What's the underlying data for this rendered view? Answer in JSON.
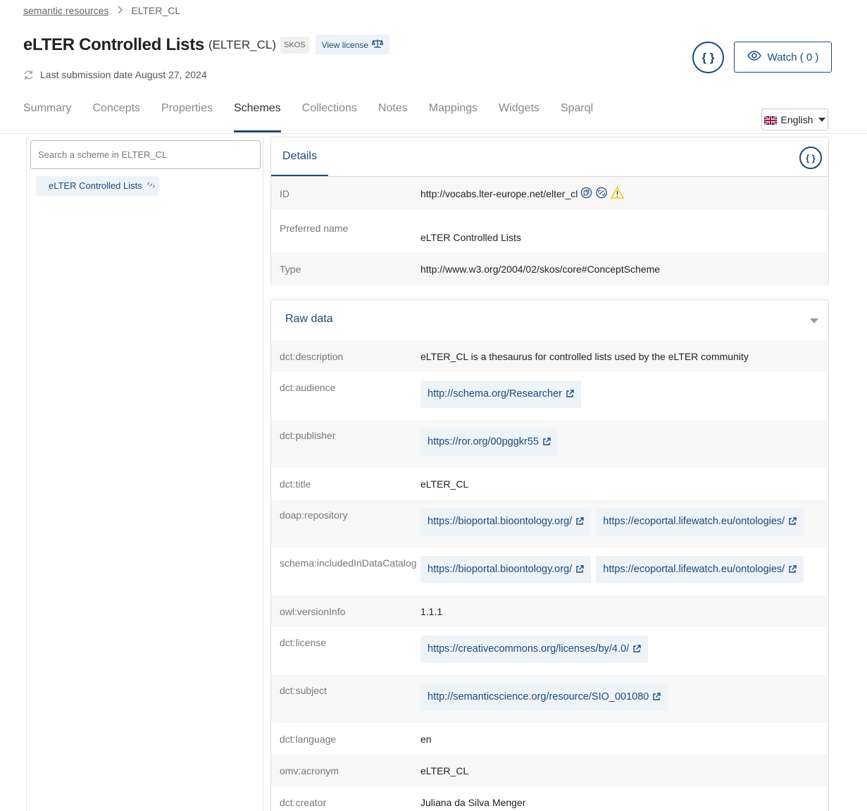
{
  "breadcrumb": {
    "root": "semantic resources",
    "current": "ELTER_CL"
  },
  "header": {
    "title": "eLTER Controlled Lists",
    "acronym": "(ELTER_CL)",
    "format": "SKOS",
    "license_label": "View license",
    "submission": "Last submission date August 27, 2024",
    "json_symbol": "{ }",
    "watch_label": "Watch ( 0 )"
  },
  "tabs": [
    "Summary",
    "Concepts",
    "Properties",
    "Schemes",
    "Collections",
    "Notes",
    "Mappings",
    "Widgets",
    "Sparql"
  ],
  "language": "English",
  "search": {
    "placeholder": "Search a scheme in ELTER_CL"
  },
  "tree": {
    "item": "eLTER Controlled Lists"
  },
  "details": {
    "tab": "Details",
    "json_symbol": "{ }",
    "rows": [
      {
        "key": "ID",
        "value": "http://vocabs.lter-europe.net/elter_cl"
      },
      {
        "key": "Preferred name",
        "value": "eLTER Controlled Lists"
      },
      {
        "key": "Type",
        "value": "http://www.w3.org/2004/02/skos/core#ConceptScheme"
      }
    ]
  },
  "raw": {
    "title": "Raw data",
    "rows": [
      {
        "key": "dct:description",
        "text": "eLTER_CL is a thesaurus for controlled lists used by the eLTER community"
      },
      {
        "key": "dct:audience",
        "links": [
          "http://schema.org/Researcher"
        ]
      },
      {
        "key": "dct:publisher",
        "links": [
          "https://ror.org/00pggkr55"
        ]
      },
      {
        "key": "dct:title",
        "text": "eLTER_CL"
      },
      {
        "key": "doap:repository",
        "links": [
          "https://bioportal.bioontology.org/",
          "https://ecoportal.lifewatch.eu/ontologies/"
        ]
      },
      {
        "key": "schema:includedInDataCatalog",
        "links": [
          "https://bioportal.bioontology.org/",
          "https://ecoportal.lifewatch.eu/ontologies/"
        ]
      },
      {
        "key": "owl:versionInfo",
        "text": "1.1.1"
      },
      {
        "key": "dct:license",
        "links": [
          "https://creativecommons.org/licenses/by/4.0/"
        ]
      },
      {
        "key": "dct:subject",
        "links": [
          "http://semanticscience.org/resource/SIO_001080"
        ]
      },
      {
        "key": "dct:language",
        "text": "en"
      },
      {
        "key": "omv:acronym",
        "text": "eLTER_CL"
      },
      {
        "key": "dct:creator",
        "text": "Juliana da Silva Menger"
      }
    ]
  },
  "colors": {
    "accent": "#1a4b7a",
    "chip_bg": "#eef3f8",
    "row_shade": "#f7f7f7",
    "warning": "#f0c419"
  }
}
